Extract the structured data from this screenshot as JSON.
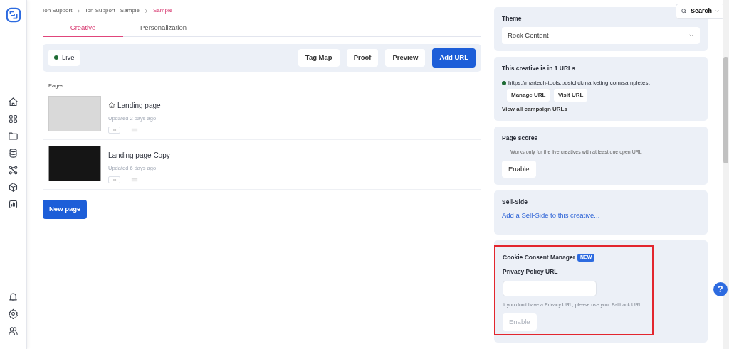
{
  "sidebar": {
    "top_items": [
      {
        "kind": "home"
      },
      {
        "kind": "apps"
      },
      {
        "kind": "folder"
      },
      {
        "kind": "database"
      },
      {
        "kind": "nodes"
      },
      {
        "kind": "cube"
      },
      {
        "kind": "chart"
      }
    ],
    "bottom_items": [
      {
        "kind": "bell"
      },
      {
        "kind": "gear"
      },
      {
        "kind": "users"
      }
    ]
  },
  "breadcrumbs": [
    {
      "label": "Ion Support",
      "current": false
    },
    {
      "label": "Ion Support - Sample",
      "current": false
    },
    {
      "label": "Sample",
      "current": true
    }
  ],
  "tabs": [
    {
      "label": "Creative",
      "selected": true
    },
    {
      "label": "Personalization",
      "selected": false
    }
  ],
  "status": {
    "label": "Live",
    "live": true
  },
  "toolbar_buttons": [
    {
      "label": "Tag Map",
      "kind": "secondary"
    },
    {
      "label": "Proof",
      "kind": "secondary"
    },
    {
      "label": "Preview",
      "kind": "secondary"
    },
    {
      "label": "Add URL",
      "kind": "primary"
    }
  ],
  "pages_heading": "Pages",
  "pages": [
    {
      "title": "Landing page",
      "home": true,
      "updated": "Updated 2 days ago",
      "kind": "form"
    },
    {
      "title": "Landing page Copy",
      "home": false,
      "updated": "Updated 6 days ago",
      "kind": "dark"
    }
  ],
  "new_page_button": "New page",
  "search": {
    "label": "Search"
  },
  "theme": {
    "label": "Theme",
    "value": "Rock Content"
  },
  "urls": {
    "title": "This creative is in 1 URLs",
    "url": "https://martech-tools.postclickmarketing.com/sampletest",
    "live": true,
    "buttons": [
      "Manage URL",
      "Visit URL"
    ],
    "link": "View all campaign URLs"
  },
  "page_scores": {
    "title": "Page scores",
    "note": "Works only for the live creatives with at least one open URL",
    "button": "Enable",
    "disabled": false
  },
  "sell_side": {
    "title": "Sell-Side",
    "link": "Add a Sell-Side to this creative..."
  },
  "cookie": {
    "title": "Cookie Consent Manager",
    "badge": "NEW",
    "field_label": "Privacy Policy URL",
    "hint": "If you don't have a Privacy URL, please use your Fallback URL.",
    "button": "Enable",
    "disabled": true,
    "highlighted": true
  },
  "help_button": "?"
}
